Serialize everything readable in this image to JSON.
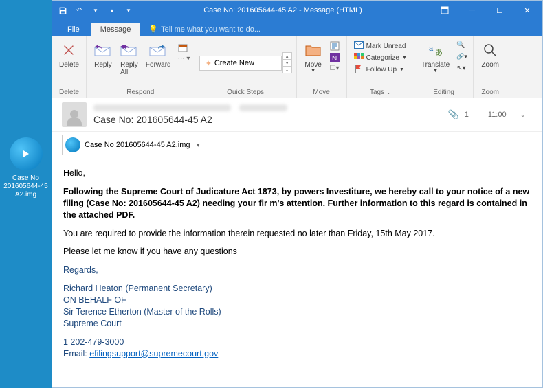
{
  "desktop": {
    "icon_label": "Case No 201605644-45 A2.img"
  },
  "titlebar": {
    "title": "Case No: 201605644-45 A2 - Message (HTML)",
    "save_icon": "save-icon",
    "undo_icon": "undo-icon"
  },
  "tabs": {
    "file": "File",
    "message": "Message",
    "tellme": "Tell me what you want to do..."
  },
  "ribbon": {
    "delete": {
      "label": "Delete",
      "group": "Delete"
    },
    "respond": {
      "reply": "Reply",
      "reply_all": "Reply\nAll",
      "forward": "Forward",
      "group": "Respond"
    },
    "quicksteps": {
      "create_new": "Create New",
      "group": "Quick Steps"
    },
    "move": {
      "move": "Move",
      "group": "Move"
    },
    "tags": {
      "unread": "Mark Unread",
      "categorize": "Categorize",
      "followup": "Follow Up",
      "group": "Tags"
    },
    "editing": {
      "translate": "Translate",
      "group": "Editing"
    },
    "zoom": {
      "zoom": "Zoom",
      "group": "Zoom"
    }
  },
  "header": {
    "subject": "Case No: 201605644-45 A2",
    "attachment_count": "1",
    "time": "11:00"
  },
  "attachment": {
    "name": "Case No 201605644-45 A2.img"
  },
  "body": {
    "greeting": "Hello,",
    "p1": "Following the Supreme Court of Judicature Act 1873, by powers Investiture, we hereby call to your notice of a new filing (Case No: 201605644-45 A2) needing your fir m's attention. Further information to this regard is contained in the attached PDF.",
    "p2": "You are required to provide the information therein requested no later than Friday, 15th May 2017.",
    "p3": "Please let me know if you have any questions",
    "regards": "Regards,",
    "sig1": "Richard Heaton (Permanent Secretary)",
    "sig2": "ON BEHALF OF",
    "sig3": "Sir Terence Etherton (Master of the Rolls)",
    "sig4": "Supreme Court",
    "phone": "1 202-479-3000",
    "email_label": "Email: ",
    "email": "efilingsupport@supremecourt.gov"
  }
}
